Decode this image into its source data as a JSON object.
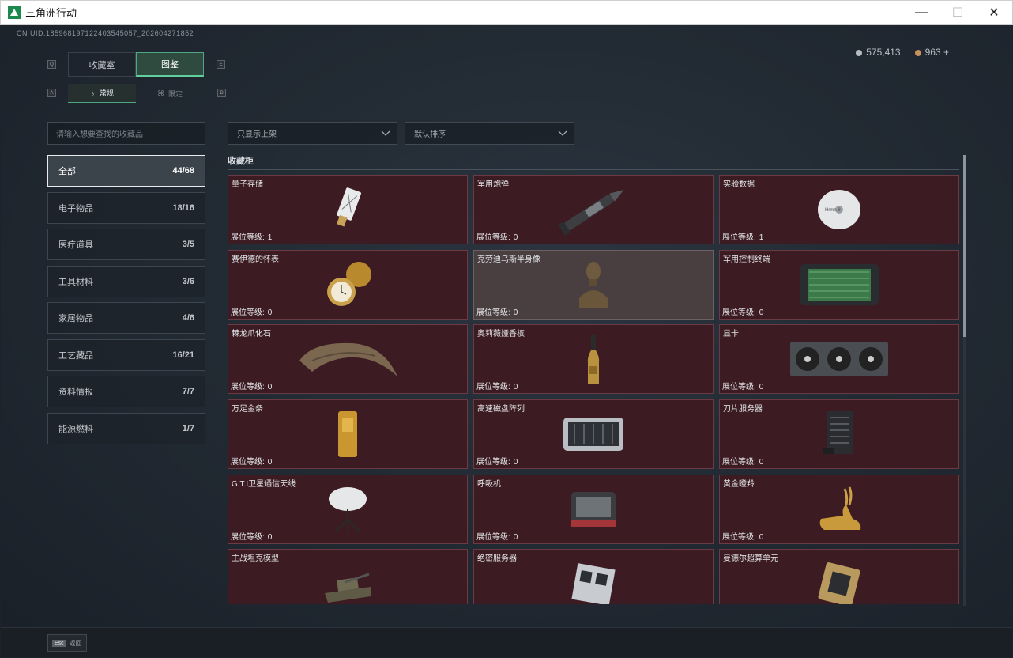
{
  "window": {
    "title": "三角洲行动",
    "minimize": "—",
    "maximize": "☐",
    "close": "✕"
  },
  "uid": "CN UID:1859681971224035450​57_202604271852",
  "currency": {
    "silver": "575,413",
    "bronze": "963",
    "plus": "+"
  },
  "key_hints": {
    "tabs_left": "Q",
    "tabs_right": "E",
    "sub_left": "A",
    "sub_right": "D"
  },
  "tabs": [
    {
      "label": "收藏室"
    },
    {
      "label": "图鉴"
    }
  ],
  "subtabs": [
    {
      "label": "常规",
      "icon": "flame-icon"
    },
    {
      "label": "限定",
      "icon": "limited-icon"
    }
  ],
  "search": {
    "placeholder": "请输入想要查找的收藏品"
  },
  "filters": {
    "shelf_filter": "只显示上架",
    "sort": "默认排序"
  },
  "categories": [
    {
      "label": "全部",
      "count": "44/68"
    },
    {
      "label": "电子物品",
      "count": "18/16"
    },
    {
      "label": "医疗道具",
      "count": "3/5"
    },
    {
      "label": "工具材料",
      "count": "3/6"
    },
    {
      "label": "家居物品",
      "count": "4/6"
    },
    {
      "label": "工艺藏品",
      "count": "16/21"
    },
    {
      "label": "资料情报",
      "count": "7/7"
    },
    {
      "label": "能源燃料",
      "count": "1/7"
    }
  ],
  "section_title": "收藏柜",
  "level_label": "展位等级:",
  "items": [
    {
      "name": "量子存储",
      "level": "1",
      "icon": "usb-drive-icon"
    },
    {
      "name": "军用炮弹",
      "level": "0",
      "icon": "artillery-shell-icon"
    },
    {
      "name": "实验数据",
      "level": "1",
      "icon": "disc-icon"
    },
    {
      "name": "赛伊德的怀表",
      "level": "0",
      "icon": "pocket-watch-icon"
    },
    {
      "name": "克劳迪乌斯半身像",
      "level": "0",
      "icon": "bust-statue-icon"
    },
    {
      "name": "军用控制终端",
      "level": "0",
      "icon": "control-terminal-icon"
    },
    {
      "name": "棘龙爪化石",
      "level": "0",
      "icon": "claw-fossil-icon"
    },
    {
      "name": "奥莉薇娅香槟",
      "level": "0",
      "icon": "champagne-bottle-icon"
    },
    {
      "name": "显卡",
      "level": "0",
      "icon": "graphics-card-icon"
    },
    {
      "name": "万足金条",
      "level": "0",
      "icon": "gold-bar-icon"
    },
    {
      "name": "高速磁盘阵列",
      "level": "0",
      "icon": "disk-array-icon"
    },
    {
      "name": "刀片服务器",
      "level": "0",
      "icon": "blade-server-icon"
    },
    {
      "name": "G.T.I卫星通信天线",
      "level": "0",
      "icon": "satellite-dish-icon"
    },
    {
      "name": "呼吸机",
      "level": "0",
      "icon": "ventilator-icon"
    },
    {
      "name": "黄金瞪羚",
      "level": "0",
      "icon": "golden-gazelle-icon"
    },
    {
      "name": "主战坦克模型",
      "level": "",
      "icon": "tank-model-icon"
    },
    {
      "name": "绝密服务器",
      "level": "",
      "icon": "secret-server-icon"
    },
    {
      "name": "曼德尔超算单元",
      "level": "",
      "icon": "supercomputer-unit-icon"
    }
  ],
  "bottom": {
    "esc_key": "Esc",
    "esc_label": "返回"
  },
  "colors": {
    "accent": "#5fd09e",
    "card_bg": "#3c1c22",
    "card_border": "#6b3b43"
  }
}
